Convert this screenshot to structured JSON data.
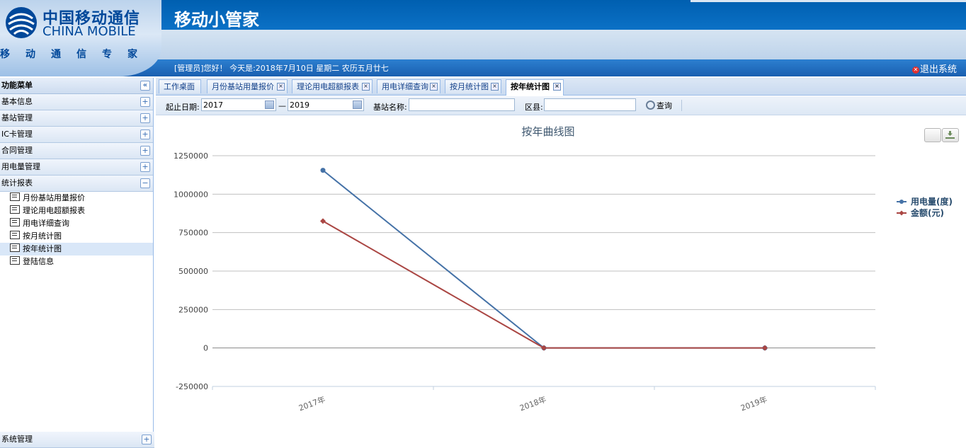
{
  "header": {
    "brand_cn": "中国移动通信",
    "brand_en": "CHINA MOBILE",
    "brand_sub": "移动通信专家",
    "app_title": "移动小管家",
    "welcome": "[管理员]您好！ 今天是:2018年7月10日 星期二 农历五月廿七",
    "logout": "退出系统"
  },
  "sidebar": {
    "title": "功能菜单",
    "items": [
      {
        "label": "基本信息",
        "expanded": false
      },
      {
        "label": "基站管理",
        "expanded": false
      },
      {
        "label": "IC卡管理",
        "expanded": false
      },
      {
        "label": "合同管理",
        "expanded": false
      },
      {
        "label": "用电量管理",
        "expanded": false
      },
      {
        "label": "统计报表",
        "expanded": true
      }
    ],
    "sub_items": [
      "月份基站用量报价",
      "理论用电超额报表",
      "用电详细查询",
      "按月统计图",
      "按年统计图",
      "登陆信息"
    ],
    "active_sub": "按年统计图",
    "bottom_item": "系统管理"
  },
  "tabs": [
    {
      "label": "工作桌面",
      "closable": false
    },
    {
      "label": "月份基站用量报价",
      "closable": true
    },
    {
      "label": "理论用电超额报表",
      "closable": true
    },
    {
      "label": "用电详细查询",
      "closable": true
    },
    {
      "label": "按月统计图",
      "closable": true
    },
    {
      "label": "按年统计图",
      "closable": true,
      "active": true
    }
  ],
  "toolbar": {
    "start_date_label": "起止日期:",
    "start_date_value": "2017",
    "date_separator": "—",
    "end_date_value": "2019",
    "station_label": "基站名称:",
    "station_value": "",
    "district_label": "区县:",
    "district_value": "",
    "search_label": "查询"
  },
  "chart_data": {
    "type": "line",
    "title": "按年曲线图",
    "categories": [
      "2017年",
      "2018年",
      "2019年"
    ],
    "series": [
      {
        "name": "用电量(度)",
        "color": "#4572a7",
        "values": [
          1155000,
          0,
          0
        ]
      },
      {
        "name": "金额(元)",
        "color": "#aa4643",
        "values": [
          825000,
          0,
          0
        ]
      }
    ],
    "ylim": [
      -250000,
      1250000
    ],
    "yticks": [
      1250000,
      1000000,
      750000,
      500000,
      250000,
      0,
      -250000
    ],
    "grid": true,
    "legend": "right"
  }
}
